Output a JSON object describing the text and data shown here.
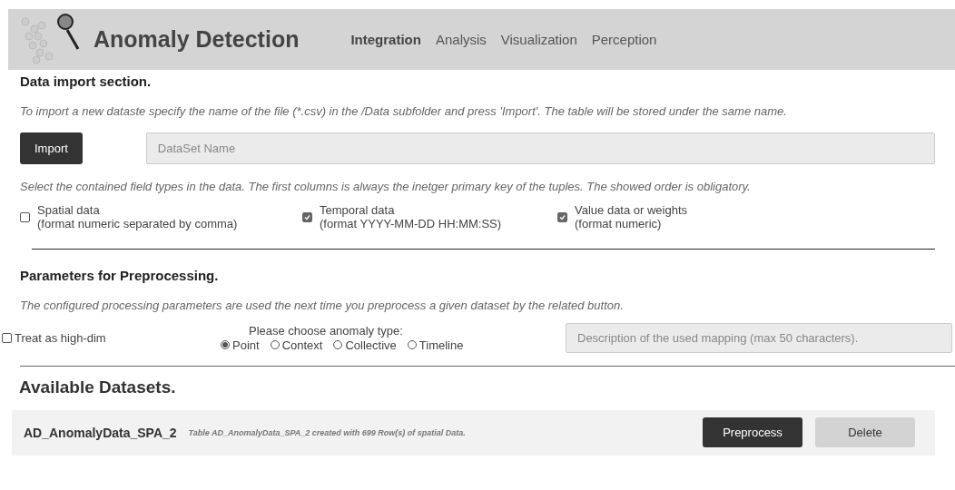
{
  "header": {
    "title": "Anomaly Detection",
    "tabs": [
      {
        "label": "Integration",
        "selected": true
      },
      {
        "label": "Analysis",
        "selected": false
      },
      {
        "label": "Visualization",
        "selected": false
      },
      {
        "label": "Perception",
        "selected": false
      }
    ]
  },
  "import_section": {
    "heading": "Data import section.",
    "instruction": "To import a new dataste specify the name of the file (*.csv) in the /Data subfolder and press 'Import'. The table will be stored under the same name.",
    "button": "Import",
    "name_field": {
      "placeholder": "DataSet Name"
    },
    "types_instruction": "Select the contained field types in the data. The first columns is always the inetger primary key of the tuples. The showed order is obligatory.",
    "field_types": [
      {
        "label": "Spatial data",
        "format": "(format numeric separated by comma)",
        "checked": false
      },
      {
        "label": "Temporal data",
        "format": "(format YYYY-MM-DD HH:MM:SS)",
        "checked": true
      },
      {
        "label": "Value data or weights",
        "format": "(format numeric)",
        "checked": true
      }
    ]
  },
  "preprocessing": {
    "heading": "Parameters for Preprocessing.",
    "instruction": "The configured processing parameters are used the next time you preprocess a given dataset by the related button.",
    "high_dim": {
      "label": "Treat as high-dim",
      "checked": false
    },
    "anomaly_prompt": "Please choose anomaly type:",
    "anomaly_types": [
      {
        "label": "Point",
        "selected": true
      },
      {
        "label": "Context",
        "selected": false
      },
      {
        "label": "Collective",
        "selected": false
      },
      {
        "label": "Timeline",
        "selected": false
      }
    ],
    "description_field": {
      "placeholder": "Description of the used mapping (max 50 characters)."
    }
  },
  "datasets": {
    "heading": "Available Datasets.",
    "items": [
      {
        "name": "AD_AnomalyData_SPA_2",
        "info": "Table AD_AnomalyData_SPA_2 created with 699 Row(s) of spatial Data.",
        "buttons": [
          "Preprocess",
          "Delete"
        ]
      }
    ]
  }
}
